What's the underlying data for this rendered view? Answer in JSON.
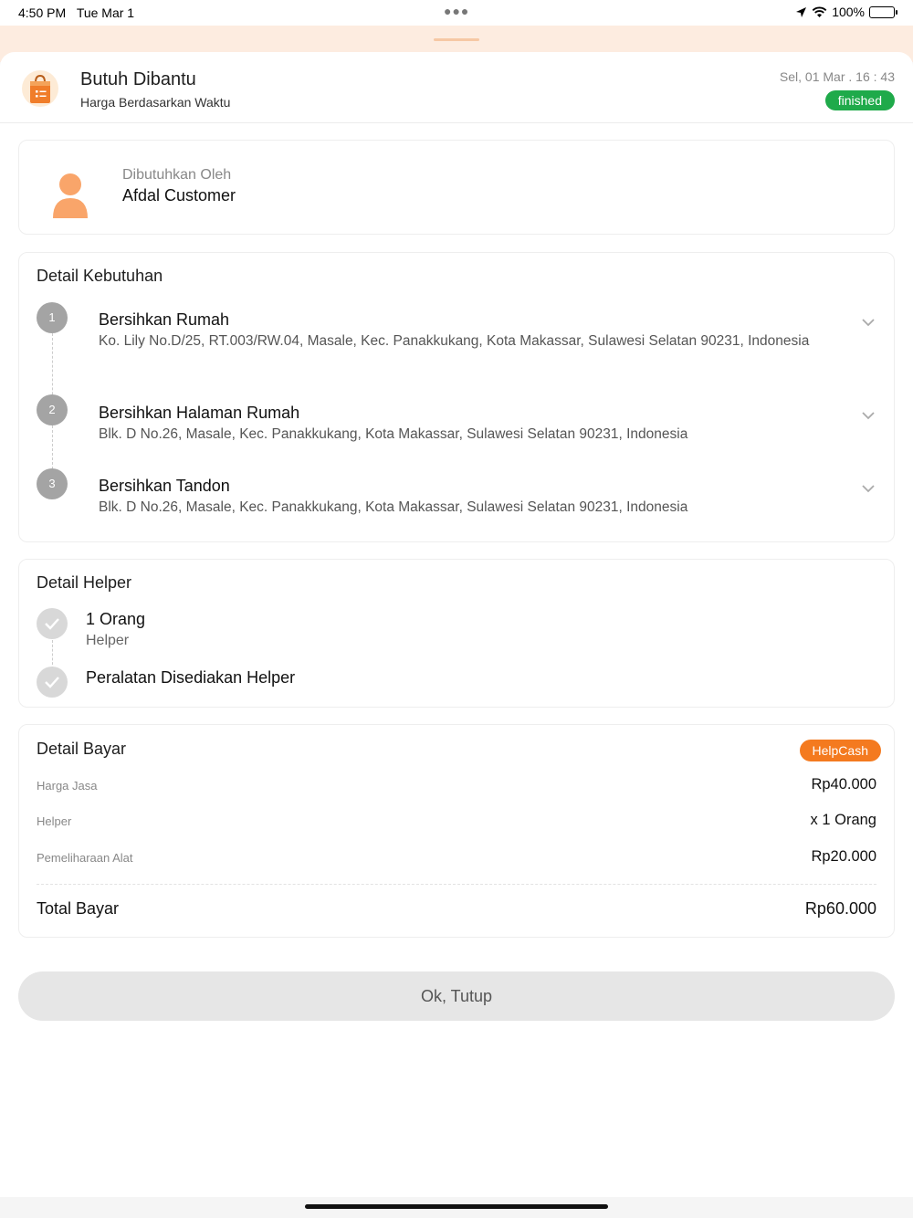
{
  "status_bar": {
    "time": "4:50 PM",
    "date": "Tue Mar 1",
    "battery": "100%",
    "icons": [
      "location-icon",
      "wifi-icon",
      "battery-icon"
    ]
  },
  "header": {
    "title": "Butuh Dibantu",
    "subtitle": "Harga Berdasarkan Waktu",
    "datetime": "Sel, 01 Mar . 16 : 43",
    "status": "finished",
    "icon": "shopping-bag-icon"
  },
  "customer": {
    "label": "Dibutuhkan Oleh",
    "name": "Afdal Customer"
  },
  "needs": {
    "title": "Detail Kebutuhan",
    "items": [
      {
        "step": "1",
        "title": "Bersihkan Rumah",
        "address": "Ko. Lily No.D/25, RT.003/RW.04, Masale, Kec. Panakkukang, Kota Makassar, Sulawesi Selatan 90231, Indonesia"
      },
      {
        "step": "2",
        "title": "Bersihkan Halaman Rumah",
        "address": "Blk. D No.26, Masale, Kec. Panakkukang, Kota Makassar, Sulawesi Selatan 90231, Indonesia"
      },
      {
        "step": "3",
        "title": "Bersihkan Tandon",
        "address": "Blk. D No.26, Masale, Kec. Panakkukang, Kota Makassar, Sulawesi Selatan 90231, Indonesia"
      }
    ]
  },
  "helper": {
    "title": "Detail Helper",
    "count": "1 Orang",
    "count_label": "Helper",
    "tools": "Peralatan Disediakan Helper"
  },
  "payment": {
    "title": "Detail Bayar",
    "method": "HelpCash",
    "rows": [
      {
        "label": "Harga Jasa",
        "value": "Rp40.000"
      },
      {
        "label": "Helper",
        "value": "x 1 Orang"
      },
      {
        "label": "Pemeliharaan Alat",
        "value": "Rp20.000"
      }
    ],
    "total_label": "Total Bayar",
    "total_value": "Rp60.000"
  },
  "actions": {
    "close_label": "Ok, Tutup"
  },
  "colors": {
    "accent": "#f47a1f",
    "status_finished": "#1faa4a",
    "avatar": "#f9a56a"
  }
}
